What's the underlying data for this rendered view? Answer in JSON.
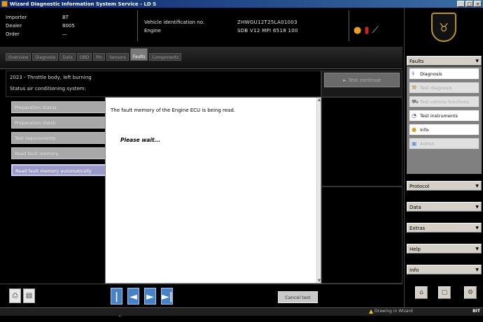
{
  "window": {
    "title": "Wizard Diagnostic Information System Service - LD S",
    "controls": [
      "_",
      "□",
      "×"
    ]
  },
  "info": {
    "labels": [
      "Importer",
      "Dealer",
      "Order"
    ],
    "values": [
      "BT",
      "8005",
      "—"
    ]
  },
  "vehicle": {
    "labels": [
      "Vehicle identification no.",
      "Engine"
    ],
    "values": [
      "ZHWGU12T25LA01003",
      "SDB V12 MPI 6518 100"
    ]
  },
  "tools": {
    "icons": [
      "hand-tools-icon",
      "battery-clamp-icon",
      "probe-icon"
    ]
  },
  "tabs": [
    {
      "label": "Overview"
    },
    {
      "label": "Diagnosis"
    },
    {
      "label": "Data"
    },
    {
      "label": "OBD"
    },
    {
      "label": "Pin"
    },
    {
      "label": "Sensors"
    },
    {
      "label": "Faults",
      "active": true
    },
    {
      "label": "Components"
    }
  ],
  "fault": {
    "title": "2023 - Throttle body, left burning",
    "status": "Status air conditioning system:"
  },
  "actions": {
    "continue_label": "► Test continue",
    "cancel_label": "Cancel test"
  },
  "steps": [
    {
      "label": "Preparation status"
    },
    {
      "label": "Preparation check"
    },
    {
      "label": "Test requirements"
    },
    {
      "label": "Read fault memory"
    },
    {
      "label": "Read fault memory automatically",
      "current": true
    }
  ],
  "message": {
    "text": "The fault memory of the Engine ECU is being read.",
    "wait": "Please wait..."
  },
  "bottom": {
    "nav": [
      "|◄",
      "◄",
      "►",
      "►|"
    ]
  },
  "sidebar": {
    "sections": [
      {
        "label": "Faults"
      },
      {
        "label": "Protocol"
      },
      {
        "label": "Data"
      },
      {
        "label": "Extras"
      },
      {
        "label": "Help"
      },
      {
        "label": "Info"
      }
    ],
    "items": [
      {
        "label": "Diagnosis",
        "icon": "stethoscope-icon",
        "glyph": "⚕",
        "enabled": true
      },
      {
        "label": "Test diagnosis",
        "icon": "hammer-icon",
        "glyph": "⚒",
        "enabled": false
      },
      {
        "label": "Test vehicle functions",
        "icon": "car-icon",
        "glyph": "⛟",
        "enabled": false
      },
      {
        "label": "Test instruments",
        "icon": "gauge-icon",
        "glyph": "◔",
        "enabled": true
      },
      {
        "label": "Info",
        "icon": "info-icon",
        "glyph": "●",
        "enabled": true
      },
      {
        "label": "Admin",
        "icon": "admin-icon",
        "glyph": "▣",
        "enabled": false
      }
    ]
  },
  "taskbar": {
    "status": "Drawing in Wizard",
    "right": "BIT"
  },
  "colors": {
    "title_gradient_start": "#0a246a",
    "step_current": "#9a9ac8",
    "nav_blue": "#4682c8"
  }
}
